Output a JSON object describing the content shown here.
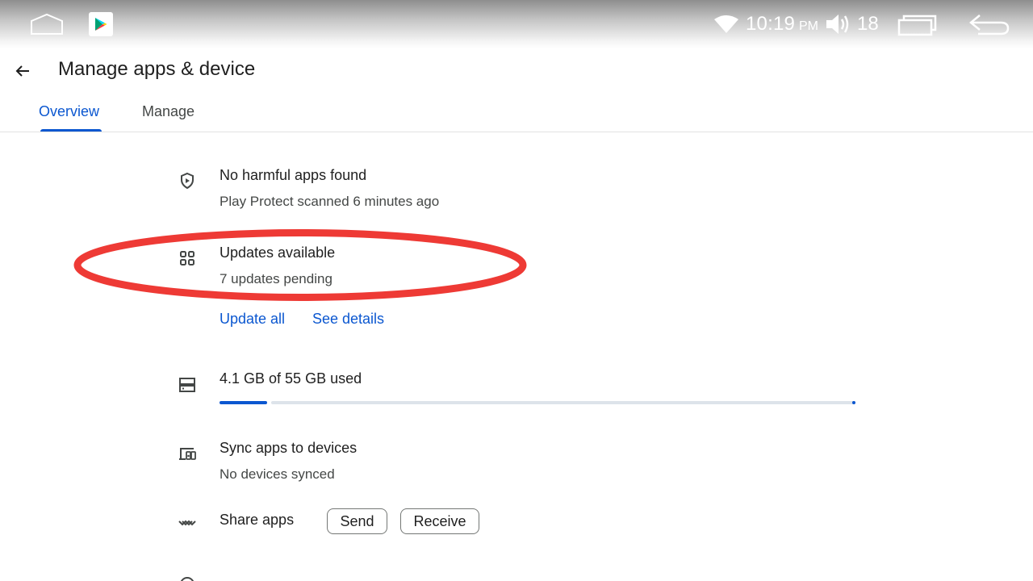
{
  "status_bar": {
    "time": "10:19",
    "ampm": "PM",
    "volume_level": "18",
    "icons": [
      "home-outline-icon",
      "play-store-icon",
      "wifi-icon",
      "volume-icon",
      "recents-icon",
      "back-nav-icon"
    ]
  },
  "app_bar": {
    "title": "Manage apps & device",
    "back_icon": "arrow-back-icon"
  },
  "tabs": [
    {
      "label": "Overview",
      "selected": true
    },
    {
      "label": "Manage",
      "selected": false
    }
  ],
  "overview": {
    "play_protect": {
      "icon": "shield-icon",
      "title": "No harmful apps found",
      "subtitle": "Play Protect scanned 6 minutes ago"
    },
    "updates": {
      "icon": "apps-grid-icon",
      "title": "Updates available",
      "subtitle": "7 updates pending",
      "update_all": "Update all",
      "see_details": "See details"
    },
    "storage": {
      "icon": "storage-icon",
      "label": "4.1 GB of 55 GB used",
      "used_gb": 4.1,
      "total_gb": 55
    },
    "sync": {
      "icon": "devices-icon",
      "title": "Sync apps to devices",
      "subtitle": "No devices synced"
    },
    "share": {
      "icon": "share-nearby-icon",
      "title": "Share apps",
      "send": "Send",
      "receive": "Receive"
    }
  },
  "colors": {
    "accent": "#0b57d0",
    "annotation": "#ee3a35",
    "text_primary": "#1f1f1f",
    "text_secondary": "#444746"
  }
}
